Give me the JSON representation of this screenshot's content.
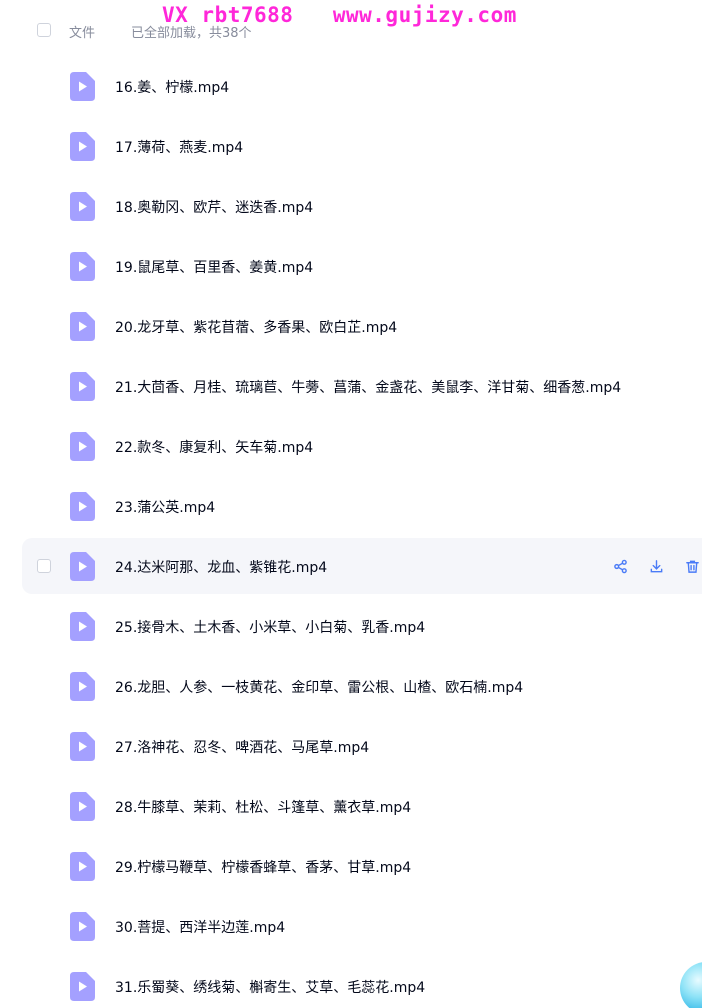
{
  "watermark": "VX rbt7688   www.gujizy.com",
  "header": {
    "label": "文件",
    "status": "已全部加载，共38个"
  },
  "colors": {
    "file_icon": "#a4a0ff",
    "action_icon": "#4a7bf7",
    "text": "#03081a",
    "muted": "#878c9c",
    "hover_bg": "#f5f6fa",
    "watermark": "#ff27d9"
  },
  "icons": {
    "file": "video-file-icon",
    "share": "share-icon",
    "download": "download-icon",
    "delete": "trash-icon"
  },
  "files": [
    {
      "name": "16.姜、柠檬.mp4"
    },
    {
      "name": "17.薄荷、燕麦.mp4"
    },
    {
      "name": "18.奥勒冈、欧芹、迷迭香.mp4"
    },
    {
      "name": "19.鼠尾草、百里香、姜黄.mp4"
    },
    {
      "name": "20.龙牙草、紫花苜蓿、多香果、欧白芷.mp4"
    },
    {
      "name": "21.大茴香、月桂、琉璃苣、牛蒡、菖蒲、金盏花、美鼠李、洋甘菊、细香葱.mp4"
    },
    {
      "name": "22.款冬、康复利、矢车菊.mp4"
    },
    {
      "name": "23.蒲公英.mp4"
    },
    {
      "name": "24.达米阿那、龙血、紫锥花.mp4",
      "hovered": true
    },
    {
      "name": "25.接骨木、土木香、小米草、小白菊、乳香.mp4"
    },
    {
      "name": "26.龙胆、人参、一枝黄花、金印草、雷公根、山楂、欧石楠.mp4"
    },
    {
      "name": "27.洛神花、忍冬、啤酒花、马尾草.mp4"
    },
    {
      "name": "28.牛膝草、茉莉、杜松、斗篷草、薰衣草.mp4"
    },
    {
      "name": "29.柠檬马鞭草、柠檬香蜂草、香茅、甘草.mp4"
    },
    {
      "name": "30.菩提、西洋半边莲.mp4"
    },
    {
      "name": "31.乐蜀葵、绣线菊、槲寄生、艾草、毛蕊花.mp4"
    }
  ]
}
